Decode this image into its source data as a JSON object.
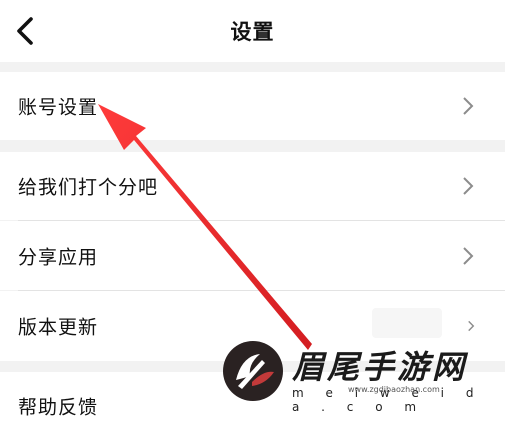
{
  "header": {
    "title": "设置",
    "back_icon": "back-chevron-icon"
  },
  "settings": {
    "account": {
      "label": "账号设置",
      "icon": "chevron-right-icon"
    },
    "rate": {
      "label": "给我们打个分吧",
      "icon": "chevron-right-icon"
    },
    "share": {
      "label": "分享应用",
      "icon": "chevron-right-icon"
    },
    "version": {
      "label": "版本更新",
      "icon": "chevron-right-icon"
    },
    "help": {
      "label": "帮助反馈"
    }
  },
  "annotation": {
    "arrow_color": "#e8262a"
  },
  "watermark": {
    "brand": "眉尾手游网",
    "url": "m e i w e i d a . c o m",
    "url2": "www.zgdibaozhan.com"
  }
}
